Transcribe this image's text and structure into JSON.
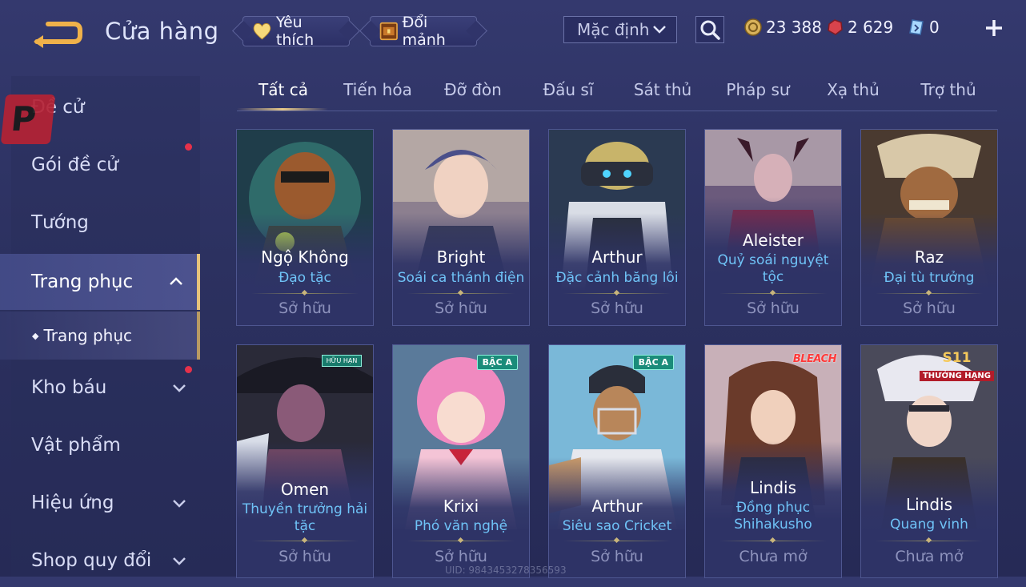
{
  "header": {
    "title": "Cửa hàng",
    "favorite_label": "Yêu thích",
    "exchange_label": "Đổi mảnh",
    "sort_value": "Mặc định",
    "currencies": {
      "gold": "23 388",
      "ruby": "2 629",
      "voucher": "0"
    }
  },
  "sidebar": {
    "items": [
      {
        "label": "Đề cử"
      },
      {
        "label": "Gói đề cử"
      },
      {
        "label": "Tướng"
      },
      {
        "label": "Trang phục"
      },
      {
        "label": "Trang phục"
      },
      {
        "label": "Kho báu"
      },
      {
        "label": "Vật phẩm"
      },
      {
        "label": "Hiệu ứng"
      },
      {
        "label": "Shop quy đổi"
      }
    ]
  },
  "tabs": [
    {
      "label": "Tất cả"
    },
    {
      "label": "Tiến hóa"
    },
    {
      "label": "Đỡ đòn"
    },
    {
      "label": "Đấu sĩ"
    },
    {
      "label": "Sát thủ"
    },
    {
      "label": "Pháp sư"
    },
    {
      "label": "Xạ thủ"
    },
    {
      "label": "Trợ thủ"
    }
  ],
  "cards": [
    {
      "hero": "Ngộ Không",
      "skin": "Đạo tặc",
      "status": "Sở hữu"
    },
    {
      "hero": "Bright",
      "skin": "Soái ca thánh điện",
      "status": "Sở hữu"
    },
    {
      "hero": "Arthur",
      "skin": "Đặc cảnh băng lôi",
      "status": "Sở hữu"
    },
    {
      "hero": "Aleister",
      "skin": "Quỷ soái nguyệt tộc",
      "status": "Sở hữu"
    },
    {
      "hero": "Raz",
      "skin": "Đại tù trưởng",
      "status": "Sở hữu"
    },
    {
      "hero": "Omen",
      "skin": "Thuyền trưởng hải tặc",
      "status": "Sở hữu",
      "badge": "HỮU HẠN"
    },
    {
      "hero": "Krixi",
      "skin": "Phó văn nghệ",
      "status": "Sở hữu",
      "badge": "BẬC A"
    },
    {
      "hero": "Arthur",
      "skin": "Siêu sao Cricket",
      "status": "Sở hữu",
      "badge": "BẬC A"
    },
    {
      "hero": "Lindis",
      "skin": "Đồng phục Shihakusho",
      "status": "Chưa mở",
      "badge": "BLEACH"
    },
    {
      "hero": "Lindis",
      "skin": "Quang vinh",
      "status": "Chưa mở",
      "badge_top": "S11",
      "badge": "THƯỞNG HẠNG"
    }
  ],
  "uid_text": "UID: 9843453278356593",
  "colors": {
    "accent_gold": "#e6c37b",
    "skin_name": "#6fc3f7",
    "notification": "#e6314a"
  },
  "icons": [
    "back-arrow-icon",
    "heart-icon",
    "chest-icon",
    "chevron-down-icon",
    "search-icon",
    "gold-coin-icon",
    "ruby-icon",
    "voucher-icon",
    "plus-icon",
    "chevron-up-icon"
  ]
}
